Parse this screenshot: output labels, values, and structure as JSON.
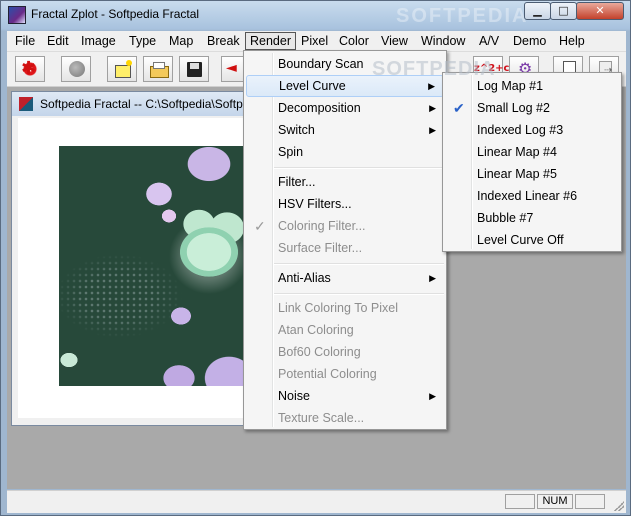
{
  "window": {
    "title": "Fractal Zplot - Softpedia Fractal",
    "caption_buttons": {
      "minimize": "▁",
      "maximize": "□",
      "close": "✕"
    }
  },
  "menubar": {
    "items": [
      "File",
      "Edit",
      "Image",
      "Type",
      "Map",
      "Break",
      "Render",
      "Pixel",
      "Color",
      "View",
      "Window",
      "A/V",
      "Demo",
      "Help"
    ],
    "active": "Render"
  },
  "toolbar": {
    "zz_label": "z^2+c",
    "icons": [
      "fractal-icon",
      "gray-ball-icon",
      "new-image-icon",
      "open-folder-icon",
      "save-disk-icon",
      "back-arrow-icon",
      "formula-icon",
      "palette-gear-icon",
      "new-document-icon",
      "export-icon"
    ]
  },
  "child_window": {
    "title": "Softpedia Fractal -- C:\\Softpedia\\Softpedia"
  },
  "render_menu": {
    "items": [
      {
        "label": "Boundary Scan",
        "enabled": true,
        "submenu": false,
        "checked": false
      },
      {
        "label": "Level Curve",
        "enabled": true,
        "submenu": true,
        "checked": false,
        "highlighted": true
      },
      {
        "label": "Decomposition",
        "enabled": true,
        "submenu": true,
        "checked": false
      },
      {
        "label": "Switch",
        "enabled": true,
        "submenu": true,
        "checked": false
      },
      {
        "label": "Spin",
        "enabled": true,
        "submenu": false,
        "checked": false
      },
      {
        "label": "Filter...",
        "enabled": true,
        "submenu": false,
        "checked": false
      },
      {
        "label": "HSV Filters...",
        "enabled": true,
        "submenu": false,
        "checked": false
      },
      {
        "label": "Coloring Filter...",
        "enabled": false,
        "submenu": false,
        "checked": true
      },
      {
        "label": "Surface Filter...",
        "enabled": false,
        "submenu": false,
        "checked": false
      },
      {
        "label": "Anti-Alias",
        "enabled": true,
        "submenu": true,
        "checked": false
      },
      {
        "label": "Link Coloring To Pixel",
        "enabled": false,
        "submenu": false,
        "checked": false
      },
      {
        "label": "Atan Coloring",
        "enabled": false,
        "submenu": false,
        "checked": false
      },
      {
        "label": "Bof60 Coloring",
        "enabled": false,
        "submenu": false,
        "checked": false
      },
      {
        "label": "Potential Coloring",
        "enabled": false,
        "submenu": false,
        "checked": false
      },
      {
        "label": "Noise",
        "enabled": true,
        "submenu": true,
        "checked": false
      },
      {
        "label": "Texture Scale...",
        "enabled": false,
        "submenu": false,
        "checked": false
      }
    ]
  },
  "level_curve_menu": {
    "items": [
      {
        "label": "Log Map #1",
        "checked": false
      },
      {
        "label": "Small Log #2",
        "checked": true
      },
      {
        "label": "Indexed Log #3",
        "checked": false
      },
      {
        "label": "Linear Map #4",
        "checked": false
      },
      {
        "label": "Linear Map #5",
        "checked": false
      },
      {
        "label": "Indexed Linear #6",
        "checked": false
      },
      {
        "label": "Bubble #7",
        "checked": false
      },
      {
        "label": "Level Curve Off",
        "checked": false
      }
    ]
  },
  "watermark": "SOFTPEDIA",
  "statusbar": {
    "num": "NUM"
  },
  "colors": {
    "menu_highlight": "#dbe9f8",
    "disabled_text": "#8d8d8d",
    "check_blue": "#2a62c8"
  }
}
